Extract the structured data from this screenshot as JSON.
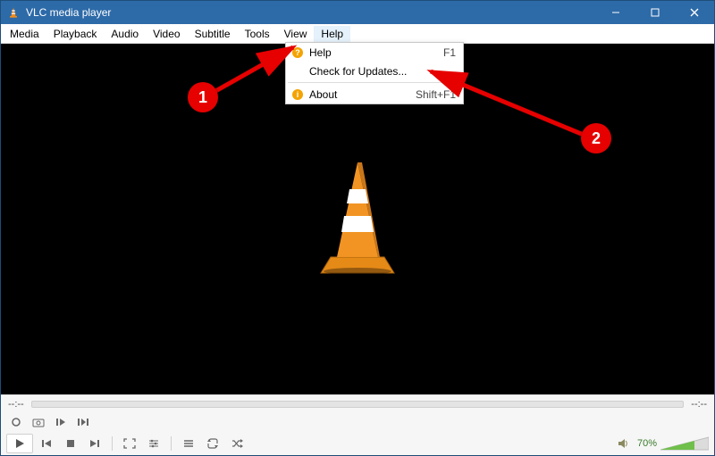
{
  "titlebar": {
    "app_title": "VLC media player"
  },
  "menubar": {
    "items": [
      "Media",
      "Playback",
      "Audio",
      "Video",
      "Subtitle",
      "Tools",
      "View",
      "Help"
    ]
  },
  "help_menu": {
    "help_label": "Help",
    "help_accel": "F1",
    "updates_label": "Check for Updates...",
    "about_label": "About",
    "about_accel": "Shift+F1"
  },
  "callouts": {
    "badge1": "1",
    "badge2": "2"
  },
  "seekbar": {
    "time_left": "--:--",
    "time_right": "--:--"
  },
  "volume": {
    "percent_label": "70%"
  }
}
